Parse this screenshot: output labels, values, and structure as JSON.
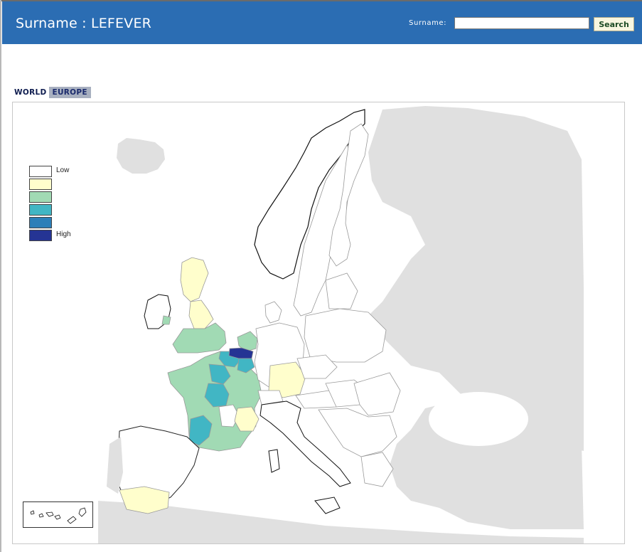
{
  "header": {
    "title": "Surname : LEFEVER",
    "search_label": "Surname:",
    "search_value": "",
    "search_button": "Search"
  },
  "tabs": [
    {
      "label": "WORLD",
      "active": false
    },
    {
      "label": "EUROPE",
      "active": true
    }
  ],
  "legend": {
    "items": [
      {
        "label": "Low",
        "color": "#ffffff"
      },
      {
        "label": "",
        "color": "#fffecc"
      },
      {
        "label": "",
        "color": "#a1dab4"
      },
      {
        "label": "",
        "color": "#41b6c4"
      },
      {
        "label": "",
        "color": "#2c7fb8"
      },
      {
        "label": "High",
        "color": "#253494"
      }
    ]
  },
  "map": {
    "level_colors": [
      "#ffffff",
      "#fffecc",
      "#a1dab4",
      "#41b6c4",
      "#2c7fb8",
      "#253494"
    ],
    "background_land": "#e0e0e0",
    "regions": [
      {
        "name": "Belgium",
        "level": 5
      },
      {
        "name": "Northern France / Nord-Pas-de-Calais",
        "level": 4
      },
      {
        "name": "Picardie / Ile-de-France",
        "level": 3
      },
      {
        "name": "Centre",
        "level": 3
      },
      {
        "name": "Aquitaine",
        "level": 3
      },
      {
        "name": "France (other regions)",
        "level": 2
      },
      {
        "name": "England (south)",
        "level": 2
      },
      {
        "name": "Scotland / North England",
        "level": 1
      },
      {
        "name": "Rhone-Alpes",
        "level": 1
      },
      {
        "name": "Bavaria",
        "level": 1
      },
      {
        "name": "Andalusia",
        "level": 1
      },
      {
        "name": "Netherlands",
        "level": 3
      }
    ]
  }
}
